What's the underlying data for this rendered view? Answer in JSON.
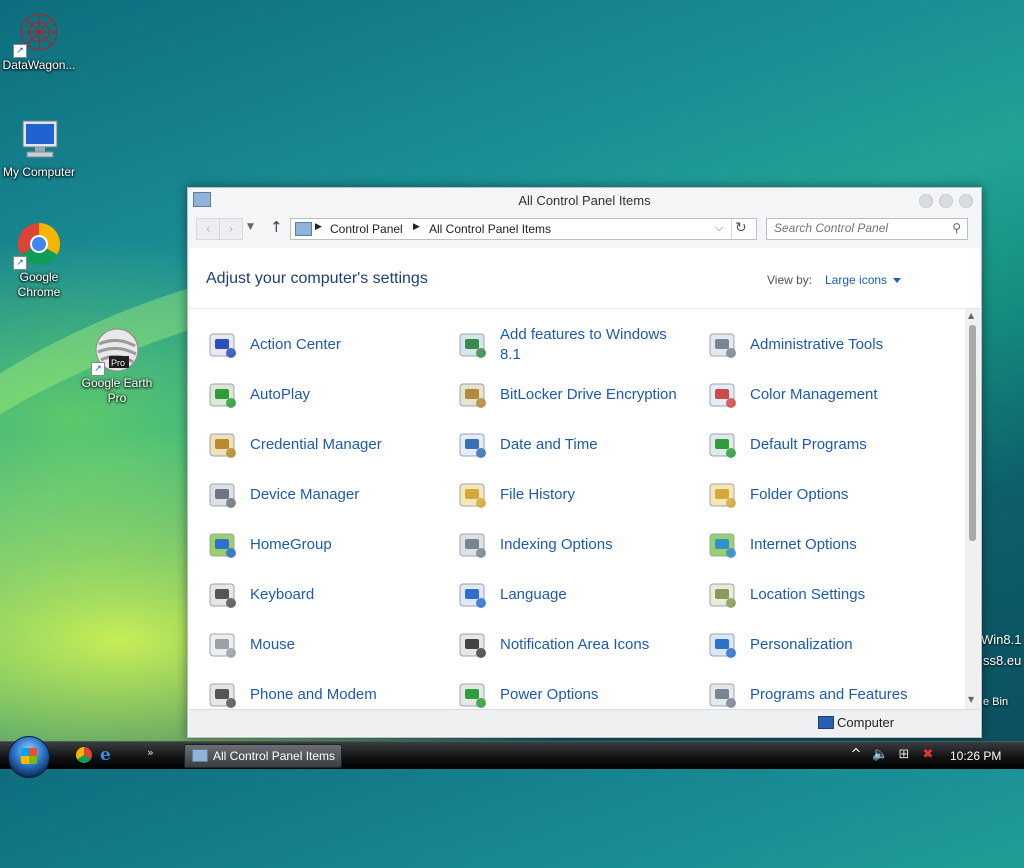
{
  "desktop": {
    "icons": [
      {
        "label": "DataWagon..."
      },
      {
        "label": "My Computer"
      },
      {
        "label": "Google Chrome"
      },
      {
        "label": "Google Earth Pro",
        "badge": "Pro"
      }
    ],
    "edge_text": {
      "line1": "Win8.1",
      "line2": "ss8.eu",
      "line3": "e Bin"
    }
  },
  "window": {
    "title": "All Control Panel Items",
    "breadcrumb": [
      "Control Panel",
      "All Control Panel Items"
    ],
    "search_placeholder": "Search Control Panel",
    "heading": "Adjust your computer's settings",
    "view_by_label": "View by:",
    "view_by_value": "Large icons",
    "status": "Computer"
  },
  "items": [
    {
      "label": "Action Center",
      "icon": "flag-icon"
    },
    {
      "label": "Add features to Windows 8.1",
      "icon": "add-features-icon"
    },
    {
      "label": "Administrative Tools",
      "icon": "admin-tools-icon"
    },
    {
      "label": "AutoPlay",
      "icon": "autoplay-icon"
    },
    {
      "label": "BitLocker Drive Encryption",
      "icon": "bitlocker-icon"
    },
    {
      "label": "Color Management",
      "icon": "color-management-icon"
    },
    {
      "label": "Credential Manager",
      "icon": "credential-icon"
    },
    {
      "label": "Date and Time",
      "icon": "calendar-clock-icon"
    },
    {
      "label": "Default Programs",
      "icon": "default-programs-icon"
    },
    {
      "label": "Device Manager",
      "icon": "device-manager-icon"
    },
    {
      "label": "File History",
      "icon": "file-history-icon"
    },
    {
      "label": "Folder Options",
      "icon": "folder-options-icon"
    },
    {
      "label": "HomeGroup",
      "icon": "homegroup-icon"
    },
    {
      "label": "Indexing Options",
      "icon": "indexing-icon"
    },
    {
      "label": "Internet Options",
      "icon": "internet-options-icon"
    },
    {
      "label": "Keyboard",
      "icon": "keyboard-icon"
    },
    {
      "label": "Language",
      "icon": "language-icon"
    },
    {
      "label": "Location Settings",
      "icon": "location-icon"
    },
    {
      "label": "Mouse",
      "icon": "mouse-icon"
    },
    {
      "label": "Notification Area Icons",
      "icon": "notification-area-icon"
    },
    {
      "label": "Personalization",
      "icon": "personalization-icon"
    },
    {
      "label": "Phone and Modem",
      "icon": "phone-icon"
    },
    {
      "label": "Power Options",
      "icon": "power-icon"
    },
    {
      "label": "Programs and Features",
      "icon": "programs-features-icon"
    }
  ],
  "taskbar": {
    "window_button": "All Control Panel Items",
    "clock": "10:26 PM"
  }
}
